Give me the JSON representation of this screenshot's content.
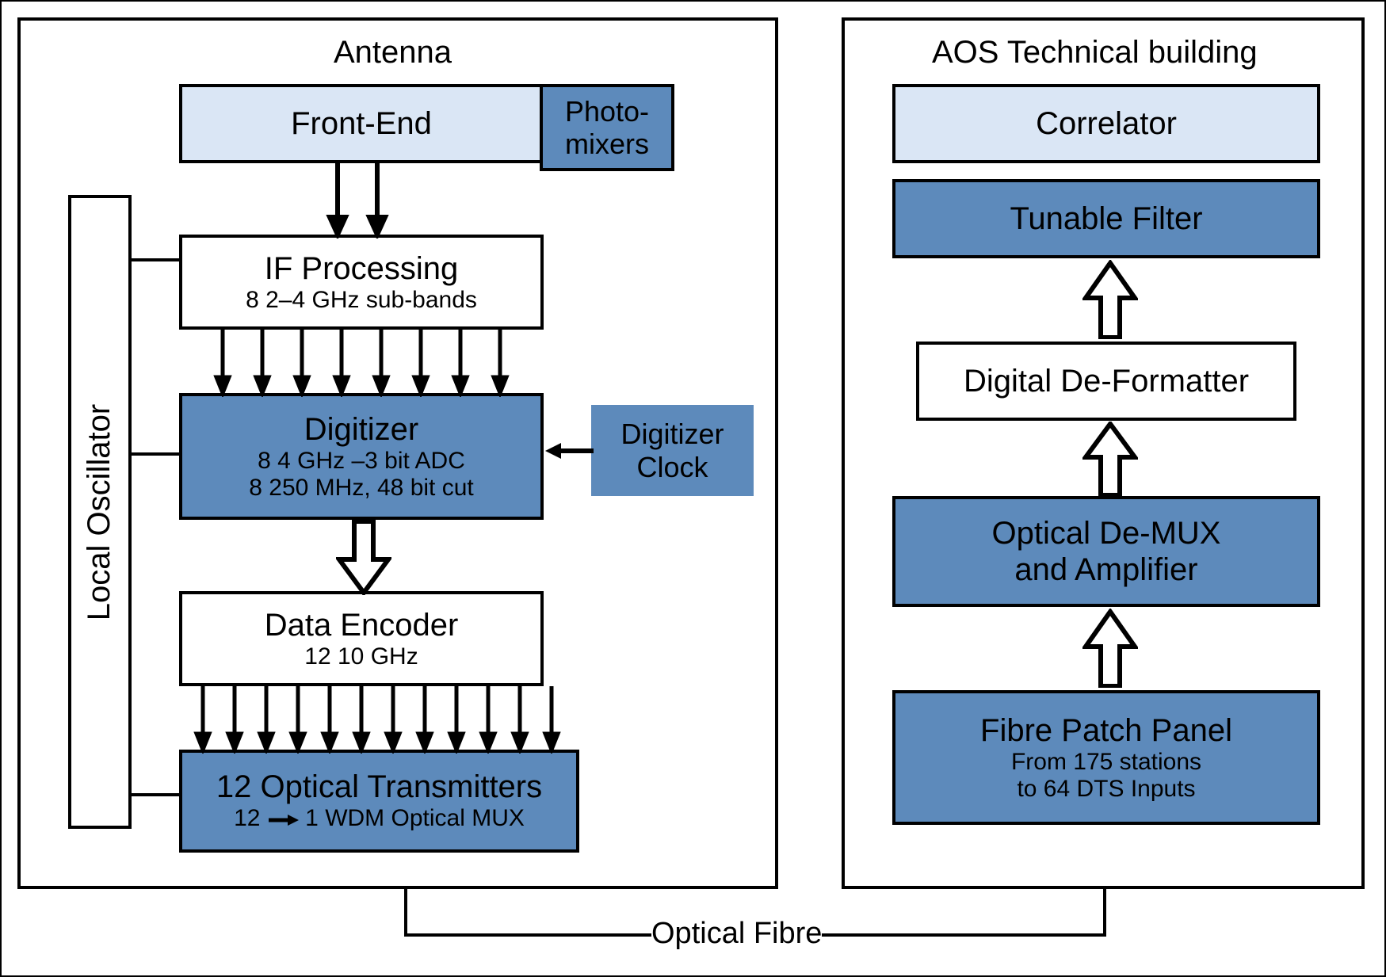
{
  "antenna": {
    "title": "Antenna",
    "front_end": "Front-End",
    "photomixers_l1": "Photo-",
    "photomixers_l2": "mixers",
    "if_proc_l1": "IF Processing",
    "if_proc_l2": "8  2–4 GHz sub-bands",
    "digitizer_l1": "Digitizer",
    "digitizer_l2": "8  4 GHz  –3 bit ADC",
    "digitizer_l3": "8  250 MHz, 48 bit cut",
    "digitizer_clock_l1": "Digitizer",
    "digitizer_clock_l2": "Clock",
    "data_enc_l1": "Data Encoder",
    "data_enc_l2": "12  10 GHz",
    "opt_tx_l1": "12 Optical Transmitters",
    "opt_tx_l2a": "12",
    "opt_tx_l2b": "1 WDM Optical MUX",
    "local_osc": "Local Oscillator"
  },
  "aos": {
    "title": "AOS Technical building",
    "correlator": "Correlator",
    "tunable_filter": "Tunable Filter",
    "deformatter": "Digital De-Formatter",
    "demux_l1": "Optical De-MUX",
    "demux_l2": "and Amplifier",
    "patch_l1": "Fibre Patch Panel",
    "patch_l2": "From 175 stations",
    "patch_l3": "to 64 DTS Inputs"
  },
  "link_caption": "Optical Fibre"
}
